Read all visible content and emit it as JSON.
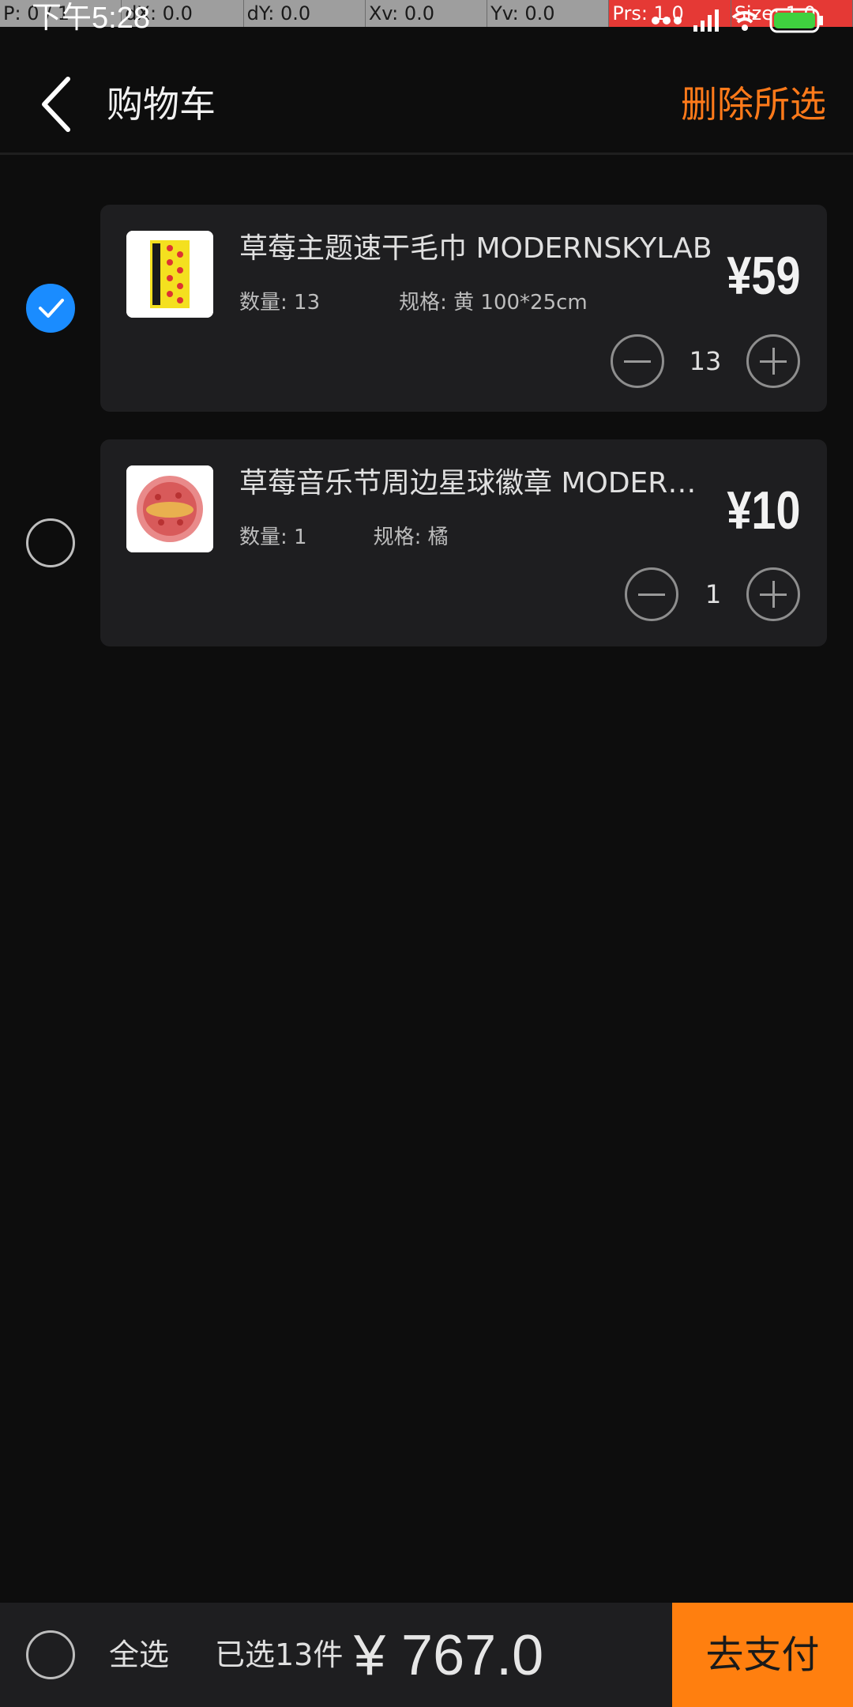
{
  "debug": {
    "cells": [
      "P: 0 / 1",
      "dX: 0.0",
      "dY: 0.0",
      "Xv: 0.0",
      "Yv: 0.0",
      "Prs: 1.0",
      "Size: 1.0"
    ]
  },
  "status": {
    "time": "下午5:28"
  },
  "header": {
    "title": "购物车",
    "delete_label": "删除所选"
  },
  "items": [
    {
      "title": "草莓主题速干毛巾 MODERNSKYLAB",
      "qty_label": "数量: 13",
      "spec_label": "规格: 黄 100*25cm",
      "price": "¥59",
      "quantity": "13",
      "checked": true
    },
    {
      "title": "草莓音乐节周边星球徽章 MODERNSKYLAB",
      "qty_label": "数量: 1",
      "spec_label": "规格: 橘",
      "price": "¥10",
      "quantity": "1",
      "checked": false
    }
  ],
  "footer": {
    "select_all_label": "全选",
    "selected_count_label": "已选13件",
    "total": "¥ 767.0",
    "pay_label": "去支付"
  },
  "colors": {
    "accent": "#ff7f0f",
    "check_blue": "#1a8cff",
    "card_bg": "#1e1e20",
    "page_bg": "#0d0d0d"
  }
}
